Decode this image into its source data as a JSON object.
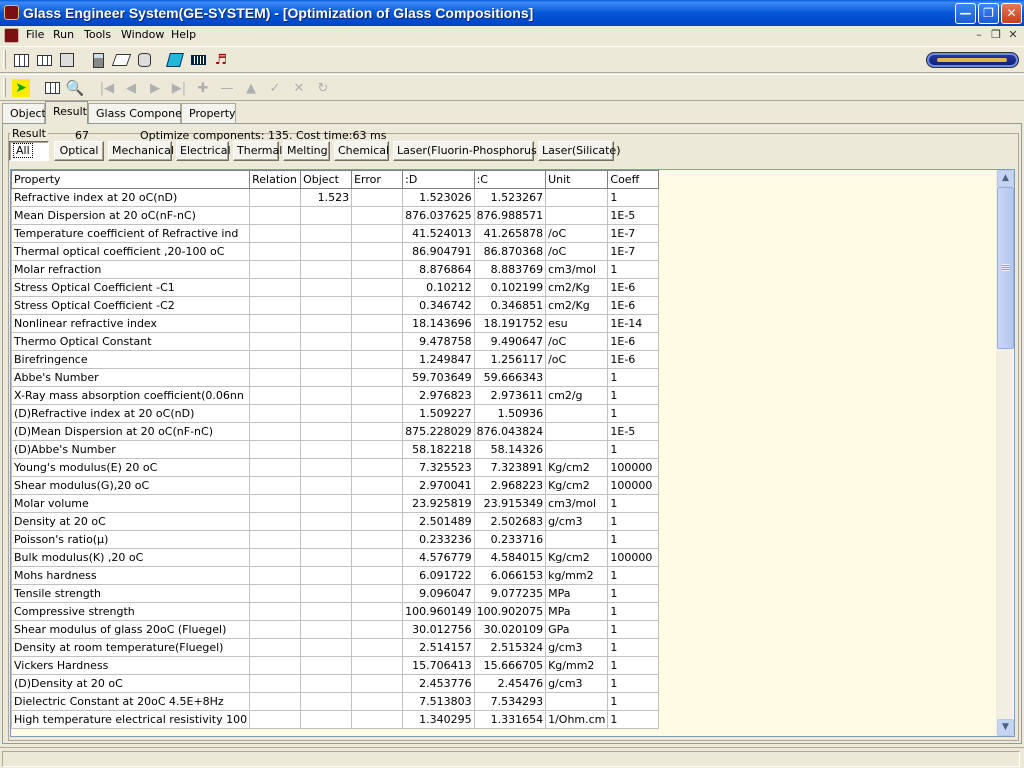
{
  "window": {
    "title": "Glass Engineer System(GE-SYSTEM) - [Optimization of Glass Compositions]"
  },
  "menu": [
    "File",
    "Run",
    "Tools",
    "Window",
    "Help"
  ],
  "tabs": [
    "Object",
    "Result",
    "Glass Component",
    "Property"
  ],
  "active_tab": "Result",
  "result": {
    "label": "Result",
    "count": "67",
    "summary": "Optimize components: 135.  Cost time:63 ms"
  },
  "filters": [
    "All",
    "Optical",
    "Mechanical",
    "Electrical",
    "Thermal",
    "Melting",
    "Chemical",
    "Laser(Fluorin-Phosphorus)",
    "Laser(Silicate)"
  ],
  "active_filter": "All",
  "grid": {
    "columns": [
      "Property",
      "Relation",
      "Object",
      "Error",
      ":D",
      ":C",
      "Unit",
      "Coeff"
    ],
    "rows": [
      [
        "Refractive index at 20 oC(nD)",
        "",
        "1.523",
        "",
        "1.523026",
        "1.523267",
        "",
        "1"
      ],
      [
        "Mean Dispersion  at 20 oC(nF-nC)",
        "",
        "",
        "",
        "876.037625",
        "876.988571",
        "",
        "1E-5"
      ],
      [
        "Temperature coefficient of Refractive ind",
        "",
        "",
        "",
        "41.524013",
        "41.265878",
        "/oC",
        "1E-7"
      ],
      [
        "Thermal optical coefficient ,20-100 oC",
        "",
        "",
        "",
        "86.904791",
        "86.870368",
        "/oC",
        "1E-7"
      ],
      [
        "Molar refraction",
        "",
        "",
        "",
        "8.876864",
        "8.883769",
        "cm3/mol",
        "1"
      ],
      [
        "Stress Optical Coefficient -C1",
        "",
        "",
        "",
        "0.10212",
        "0.102199",
        "cm2/Kg",
        "1E-6"
      ],
      [
        "Stress Optical Coefficient -C2",
        "",
        "",
        "",
        "0.346742",
        "0.346851",
        "cm2/Kg",
        "1E-6"
      ],
      [
        "Nonlinear refractive index",
        "",
        "",
        "",
        "18.143696",
        "18.191752",
        "esu",
        "1E-14"
      ],
      [
        "Thermo Optical Constant",
        "",
        "",
        "",
        "9.478758",
        "9.490647",
        "/oC",
        "1E-6"
      ],
      [
        "Birefringence",
        "",
        "",
        "",
        "1.249847",
        "1.256117",
        "/oC",
        "1E-6"
      ],
      [
        "Abbe's Number",
        "",
        "",
        "",
        "59.703649",
        "59.666343",
        "",
        "1"
      ],
      [
        "X-Ray mass absorption coefficient(0.06nn",
        "",
        "",
        "",
        "2.976823",
        "2.973611",
        "cm2/g",
        "1"
      ],
      [
        "(D)Refractive index at 20 oC(nD)",
        "",
        "",
        "",
        "1.509227",
        "1.50936",
        "",
        "1"
      ],
      [
        "(D)Mean Dispersion  at 20 oC(nF-nC)",
        "",
        "",
        "",
        "875.228029",
        "876.043824",
        "",
        "1E-5"
      ],
      [
        "(D)Abbe's Number",
        "",
        "",
        "",
        "58.182218",
        "58.14326",
        "",
        "1"
      ],
      [
        "Young's modulus(E) 20 oC",
        "",
        "",
        "",
        "7.325523",
        "7.323891",
        "Kg/cm2",
        "100000"
      ],
      [
        "Shear modulus(G),20 oC",
        "",
        "",
        "",
        "2.970041",
        "2.968223",
        "Kg/cm2",
        "100000"
      ],
      [
        "Molar volume",
        "",
        "",
        "",
        "23.925819",
        "23.915349",
        "cm3/mol",
        "1"
      ],
      [
        "Density at 20 oC",
        "",
        "",
        "",
        "2.501489",
        "2.502683",
        "g/cm3",
        "1"
      ],
      [
        "Poisson's ratio(μ)",
        "",
        "",
        "",
        "0.233236",
        "0.233716",
        "",
        "1"
      ],
      [
        "Bulk modulus(K) ,20 oC",
        "",
        "",
        "",
        "4.576779",
        "4.584015",
        "Kg/cm2",
        "100000"
      ],
      [
        "Mohs hardness",
        "",
        "",
        "",
        "6.091722",
        "6.066153",
        "kg/mm2",
        "1"
      ],
      [
        "Tensile strength",
        "",
        "",
        "",
        "9.096047",
        "9.077235",
        "MPa",
        "1"
      ],
      [
        "Compressive strength",
        "",
        "",
        "",
        "100.960149",
        "100.902075",
        "MPa",
        "1"
      ],
      [
        "Shear modulus of glass 20oC (Fluegel)",
        "",
        "",
        "",
        "30.012756",
        "30.020109",
        "GPa",
        "1"
      ],
      [
        "Density at room temperature(Fluegel)",
        "",
        "",
        "",
        "2.514157",
        "2.515324",
        "g/cm3",
        "1"
      ],
      [
        "Vickers Hardness",
        "",
        "",
        "",
        "15.706413",
        "15.666705",
        "Kg/mm2",
        "1"
      ],
      [
        "(D)Density at 20 oC",
        "",
        "",
        "",
        "2.453776",
        "2.45476",
        "g/cm3",
        "1"
      ],
      [
        "Dielectric Constant at 20oC 4.5E+8Hz",
        "",
        "",
        "",
        "7.513803",
        "7.534293",
        "",
        "1"
      ],
      [
        "High temperature electrical resistivity 100",
        "",
        "",
        "",
        "1.340295",
        "1.331654",
        "1/Ohm.cm",
        "1"
      ]
    ]
  },
  "icons": {
    "toolbar1": [
      "table-icon",
      "form-icon",
      "documents-icon",
      "calculator-icon",
      "book-icon",
      "database-icon",
      "cyan-book-icon",
      "barcode-icon",
      "speaker-icon"
    ],
    "toolbar2": [
      "run-icon",
      "report-icon",
      "preview-icon",
      "first-icon",
      "prev-icon",
      "next-icon",
      "last-icon",
      "insert-icon",
      "delete-icon",
      "edit-icon",
      "post-icon",
      "cancel-icon",
      "refresh-icon"
    ]
  }
}
